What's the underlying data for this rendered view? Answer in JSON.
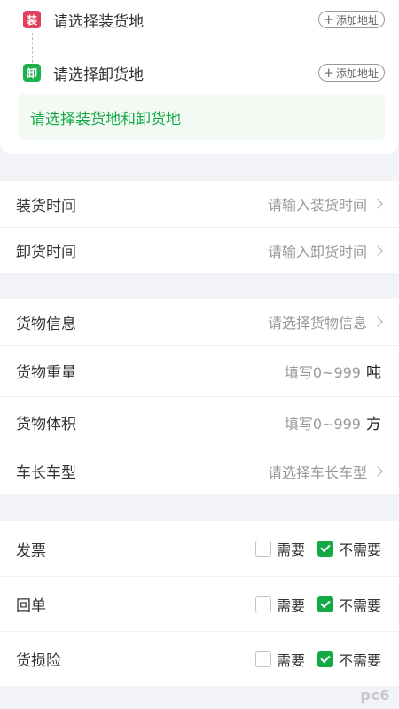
{
  "route": {
    "load": {
      "tag": "装",
      "placeholder": "请选择装货地",
      "add_label": "添加地址"
    },
    "unload": {
      "tag": "卸",
      "placeholder": "请选择卸货地",
      "add_label": "添加地址"
    },
    "hint": "请选择装货地和卸货地"
  },
  "times": [
    {
      "label": "装货时间",
      "placeholder": "请输入装货时间"
    },
    {
      "label": "卸货时间",
      "placeholder": "请输入卸货时间"
    }
  ],
  "cargo": {
    "info": {
      "label": "货物信息",
      "placeholder": "请选择货物信息"
    },
    "weight": {
      "label": "货物重量",
      "placeholder": "填写0~999",
      "unit": "吨"
    },
    "volume": {
      "label": "货物体积",
      "placeholder": "填写0~999",
      "unit": "方"
    },
    "vehicle": {
      "label": "车长车型",
      "placeholder": "请选择车长车型"
    }
  },
  "options": [
    {
      "label": "发票",
      "need": "需要",
      "no_need": "不需要",
      "selected": "不需要"
    },
    {
      "label": "回单",
      "need": "需要",
      "no_need": "不需要",
      "selected": "不需要"
    },
    {
      "label": "货损险",
      "need": "需要",
      "no_need": "不需要",
      "selected": "不需要"
    }
  ],
  "watermark": "pc6",
  "colors": {
    "load_tag": "#e0405e",
    "unload_tag": "#1fb04e",
    "accent_green": "#13a946",
    "page_bg": "#f2f3f7"
  }
}
